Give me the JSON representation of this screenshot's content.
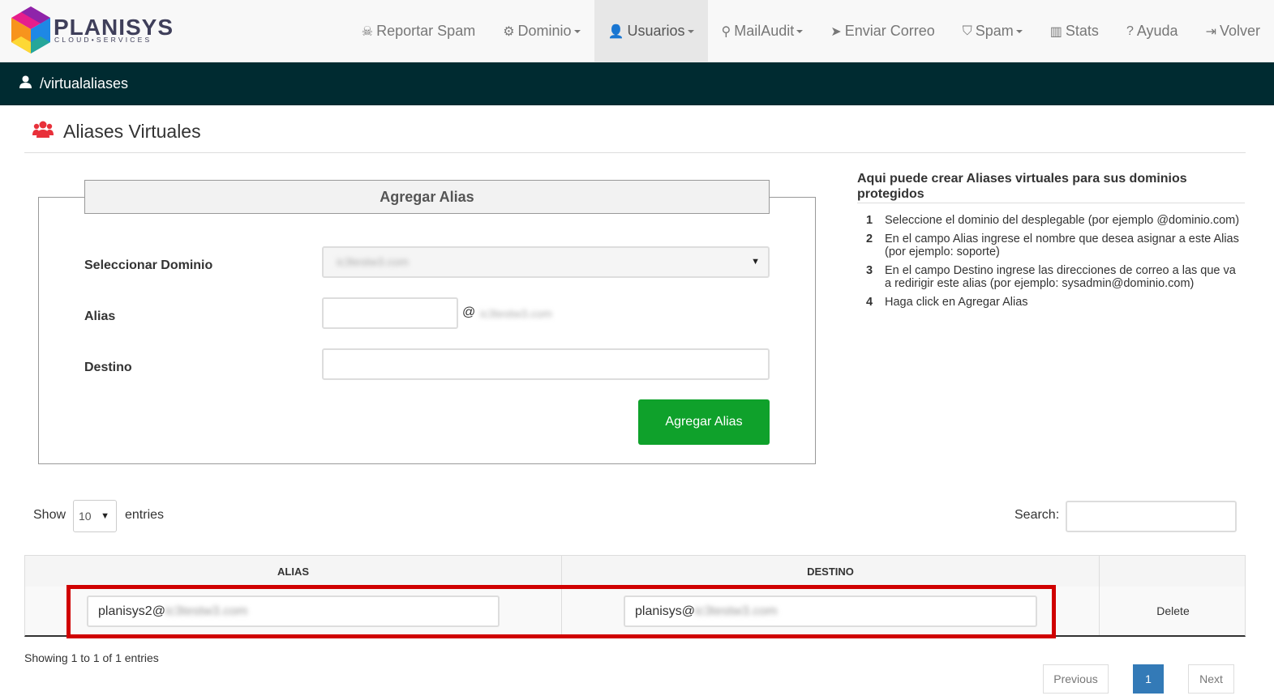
{
  "brand": {
    "name": "PLANISYS",
    "tagline": "CLOUD•SERVICES"
  },
  "nav": [
    {
      "label": "Reportar Spam",
      "icon": "skull-icon",
      "glyph": "☠"
    },
    {
      "label": "Dominio",
      "icon": "gear-icon",
      "glyph": "⚙",
      "dropdown": true
    },
    {
      "label": "Usuarios",
      "icon": "user-icon",
      "glyph": "👤",
      "dropdown": true,
      "active": true
    },
    {
      "label": "MailAudit",
      "icon": "search-icon",
      "glyph": "⚲",
      "dropdown": true
    },
    {
      "label": "Enviar Correo",
      "icon": "paper-plane-icon",
      "glyph": "➤"
    },
    {
      "label": "Spam",
      "icon": "shield-icon",
      "glyph": "⛉",
      "dropdown": true
    },
    {
      "label": "Stats",
      "icon": "bar-chart-icon",
      "glyph": "▥"
    },
    {
      "label": "Ayuda",
      "icon": "question-icon",
      "glyph": "?"
    },
    {
      "label": "Volver",
      "icon": "sign-in-icon",
      "glyph": "⇥"
    }
  ],
  "breadcrumb": {
    "path": "/virtualaliases"
  },
  "page": {
    "title": "Aliases Virtuales"
  },
  "form": {
    "heading": "Agregar Alias",
    "domain_label": "Seleccionar Dominio",
    "domain_value": "ic3testw3.com",
    "alias_label": "Alias",
    "alias_value": "",
    "at_sign": "@",
    "alias_domain": "ic3testw3.com",
    "dest_label": "Destino",
    "dest_value": "",
    "submit_label": "Agregar Alias"
  },
  "help": {
    "title": "Aqui puede crear Aliases virtuales para sus dominios protegidos",
    "steps": [
      {
        "n": "1",
        "text": "Seleccione el dominio del desplegable (por ejemplo @dominio.com)"
      },
      {
        "n": "2",
        "text": "En el campo Alias ingrese el nombre que desea asignar a este Alias (por ejemplo: soporte)"
      },
      {
        "n": "3",
        "text": "En el campo Destino ingrese las direcciones de correo a las que va a redirigir este alias (por ejemplo: sysadmin@dominio.com)"
      },
      {
        "n": "4",
        "text": "Haga click en Agregar Alias"
      }
    ]
  },
  "table": {
    "show_label": "Show",
    "page_length": "10",
    "entries_label": "entries",
    "search_label": "Search:",
    "search_value": "",
    "columns": [
      "ALIAS",
      "DESTINO",
      ""
    ],
    "rows": [
      {
        "alias_local": "planisys2@",
        "alias_domain": "ic3testw3.com",
        "dest_local": "planisys@",
        "dest_domain": "ic3testw3.com",
        "action": "Delete"
      }
    ],
    "info": "Showing 1 to 1 of 1 entries",
    "pagination": {
      "previous": "Previous",
      "current": "1",
      "next": "Next"
    }
  },
  "colors": {
    "navbar_bg": "#f8f8f8",
    "breadcrumb_bg": "#002b31",
    "submit_green": "#0fa12b",
    "highlight_red": "#d00000",
    "page_active": "#337ab7"
  }
}
